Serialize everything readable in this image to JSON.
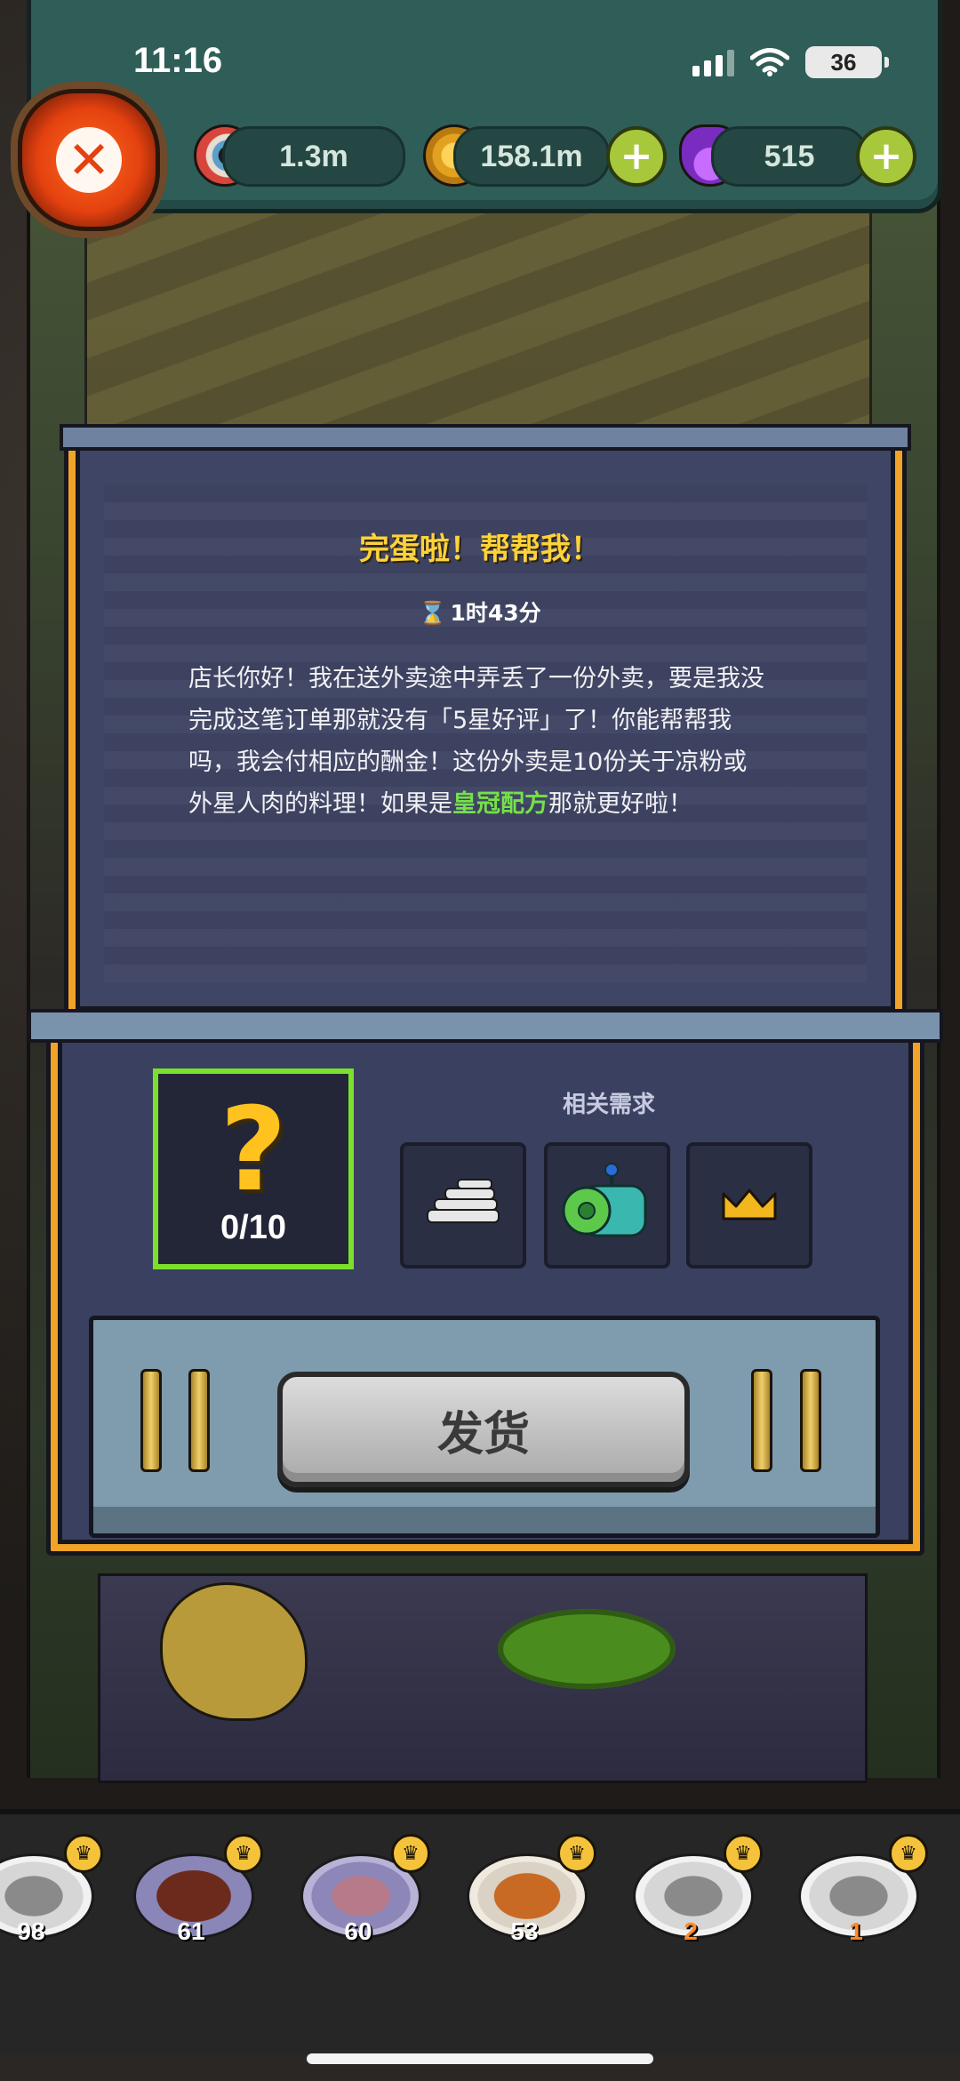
{
  "status_bar": {
    "time": "11:16",
    "battery": "36"
  },
  "hud": {
    "eyes": "1.3m",
    "coins": "158.1m",
    "potions": "515",
    "icons": [
      "eyeball-icon",
      "coin-icon",
      "potion-icon",
      "plus-icon",
      "close-icon"
    ]
  },
  "dialog": {
    "title": "完蛋啦！帮帮我！",
    "timer": "1时43分",
    "message_before": "店长你好！我在送外卖途中弄丢了一份外卖，要是我没完成这笔订单那就没有「5星好评」了！你能帮帮我吗，我会付相应的酬金！这份外卖是10份关于凉粉或外星人肉的料理！如果是",
    "message_highlight": "皇冠配方",
    "message_after": "那就更好啦！",
    "requirement_count": "0/10",
    "related_title": "相关需求",
    "related_items": [
      "rice-noodles-icon",
      "alien-meat-icon",
      "crown-icon"
    ],
    "ship_button": "发货",
    "colors": {
      "title": "#ffd23a",
      "highlight": "#76e04a",
      "slot_border": "#7be02c",
      "frame": "#f0a326"
    }
  },
  "recipes": [
    {
      "count": "98",
      "style": "gray"
    },
    {
      "count": "61",
      "style": "steak"
    },
    {
      "count": "60",
      "style": "purple"
    },
    {
      "count": "53",
      "style": "orange"
    },
    {
      "count": "2",
      "style": "gray"
    },
    {
      "count": "1",
      "style": "gray"
    }
  ]
}
